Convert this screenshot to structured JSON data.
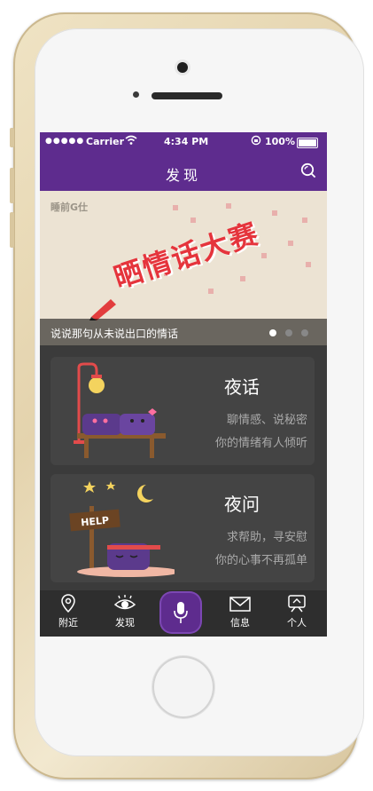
{
  "status": {
    "carrier": "Carrier",
    "time": "4:34 PM",
    "battery": "100%"
  },
  "nav": {
    "title": "发现",
    "icons": {
      "search": "search-icon"
    }
  },
  "banner": {
    "stamp": "睡前G仕",
    "contest_title": "晒情话大赛",
    "caption": "说说那句从未说出口的情话",
    "carousel_active": 1,
    "carousel_total": 3
  },
  "cards": [
    {
      "title": "夜话",
      "line1": "聊情感、说秘密",
      "line2": "你的情绪有人倾听"
    },
    {
      "title": "夜问",
      "line1": "求帮助，寻安慰",
      "line2": "你的心事不再孤单",
      "sign_text": "HELP"
    }
  ],
  "tabs": [
    {
      "label": "附近",
      "icon": "location-pin-icon"
    },
    {
      "label": "发现",
      "icon": "eye-icon"
    },
    {
      "label": "",
      "icon": "microphone-icon"
    },
    {
      "label": "信息",
      "icon": "mail-icon"
    },
    {
      "label": "个人",
      "icon": "profile-icon"
    }
  ],
  "colors": {
    "brand_purple": "#5e2c8e",
    "screen_dark": "#3b3b3b",
    "card_bg": "#444444",
    "contest_red": "#e5343c"
  }
}
